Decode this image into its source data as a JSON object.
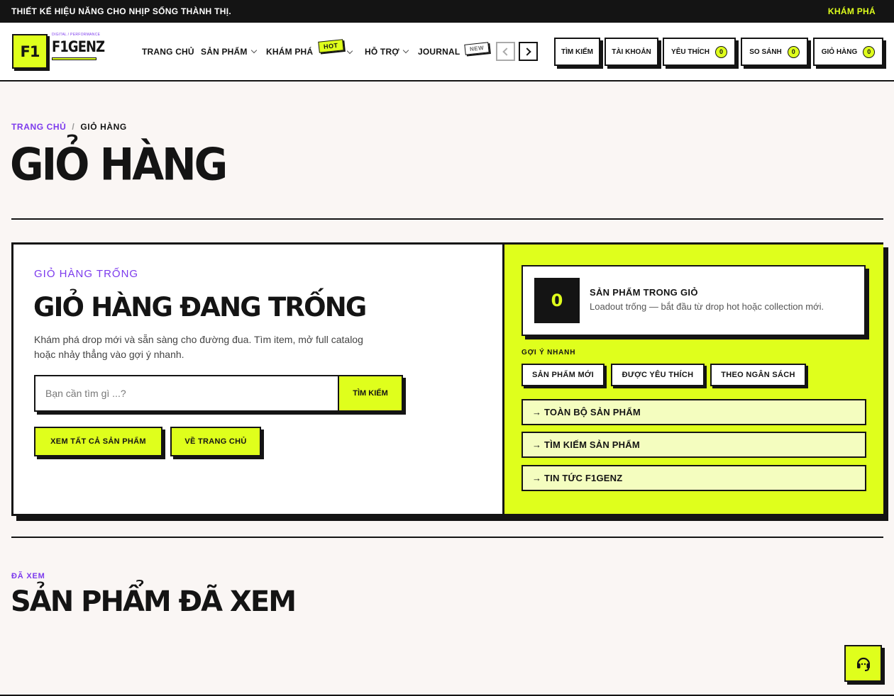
{
  "topbar": {
    "message": "THIẾT KẾ HIỆU NĂNG CHO NHỊP SỐNG THÀNH THỊ.",
    "cta": "KHÁM PHÁ"
  },
  "logo": {
    "mark": "F1",
    "tagline": "DIGITAL / PERFORMANCE",
    "word": "F1GENZ"
  },
  "nav": {
    "items": [
      "TRANG CHỦ",
      "SẢN PHẨM",
      "KHÁM PHÁ",
      "HỖ TRỢ",
      "JOURNAL"
    ],
    "hot_badge": "HOT",
    "new_badge": "NEW"
  },
  "header_actions": {
    "search": "TÌM KIẾM",
    "account": "TÀI KHOẢN",
    "wishlist": "YÊU THÍCH",
    "wishlist_count": "0",
    "compare": "SO SÁNH",
    "compare_count": "0",
    "cart": "GIỎ HÀNG",
    "cart_count": "0"
  },
  "breadcrumb": {
    "home": "TRANG CHỦ",
    "sep": "/",
    "current": "GIỎ HÀNG"
  },
  "page_title": "GIỎ HÀNG",
  "empty_cart": {
    "eyebrow": "GIỎ HÀNG TRỐNG",
    "title": "GIỎ HÀNG ĐANG TRỐNG",
    "description": "Khám phá drop mới và sẵn sàng cho đường đua. Tìm item, mở full catalog hoặc nhảy thẳng vào gợi ý nhanh.",
    "search_placeholder": "Bạn cần tìm gì ...?",
    "search_button": "TÌM KIẾM",
    "view_all": "XEM TẤT CẢ SẢN PHẨM",
    "go_home": "VỀ TRANG CHỦ"
  },
  "summary": {
    "count": "0",
    "title": "SẢN PHẨM TRONG GIỎ",
    "subtitle": "Loadout trống — bắt đầu từ drop hot hoặc collection mới.",
    "quick_label": "GỢI Ý NHANH",
    "chips": [
      "SẢN PHẨM MỚI",
      "ĐƯỢC YÊU THÍCH",
      "THEO NGÂN SÁCH"
    ],
    "links": [
      "→ TOÀN BỘ SẢN PHẨM",
      "→ TÌM KIẾM SẢN PHẨM",
      "→ TIN TỨC F1GENZ"
    ]
  },
  "recently_viewed": {
    "eyebrow": "ĐÃ XEM",
    "title": "SẢN PHẨM ĐÃ XEM"
  },
  "colors": {
    "accent": "#dfff1c",
    "ink": "#141414",
    "purple": "#7c3aed",
    "background": "#faf6f4"
  },
  "icons": {
    "support": "headset-icon",
    "prev": "chevron-left-icon",
    "next": "chevron-right-icon"
  }
}
